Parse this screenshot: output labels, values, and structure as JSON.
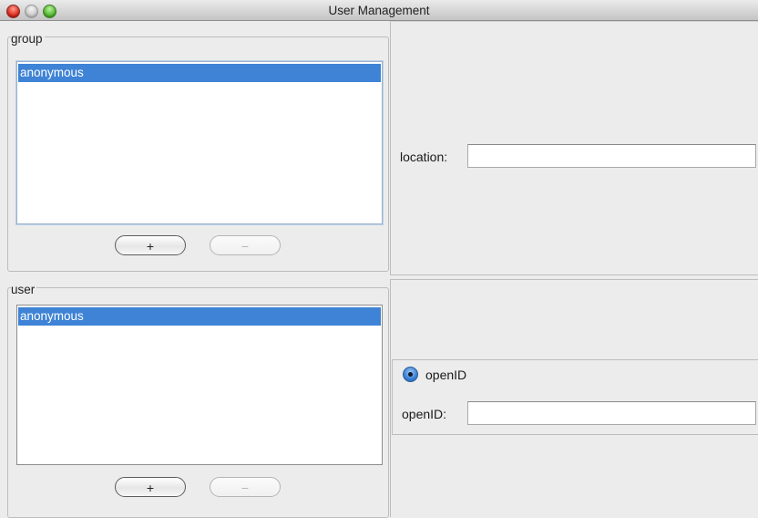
{
  "window": {
    "title": "User Management"
  },
  "group_panel": {
    "legend": "group",
    "items": [
      "anonymous"
    ],
    "add_label": "+",
    "remove_label": "−"
  },
  "user_panel": {
    "legend": "user",
    "items": [
      "anonymous"
    ],
    "add_label": "+",
    "remove_label": "−"
  },
  "location": {
    "label": "location:",
    "value": ""
  },
  "auth": {
    "radio_label": "openID",
    "radio_selected": true,
    "field_label": "openID:",
    "field_value": ""
  }
}
